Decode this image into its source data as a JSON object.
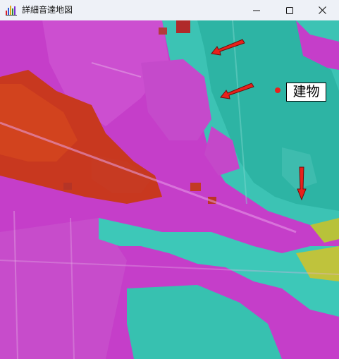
{
  "window": {
    "title": "詳細音達地図",
    "controls": {
      "minimize": "minimize-icon",
      "maximize": "maximize-icon",
      "close": "close-icon"
    }
  },
  "map": {
    "marker_label": "建物",
    "marker_color": "#e8211c",
    "arrow_color": "#e8211c",
    "legend_colors": {
      "high": "#c9331e",
      "medium_high": "#b23cc4",
      "medium": "#d946d8",
      "low": "#35c7b8",
      "lowest": "#c8c042"
    }
  }
}
